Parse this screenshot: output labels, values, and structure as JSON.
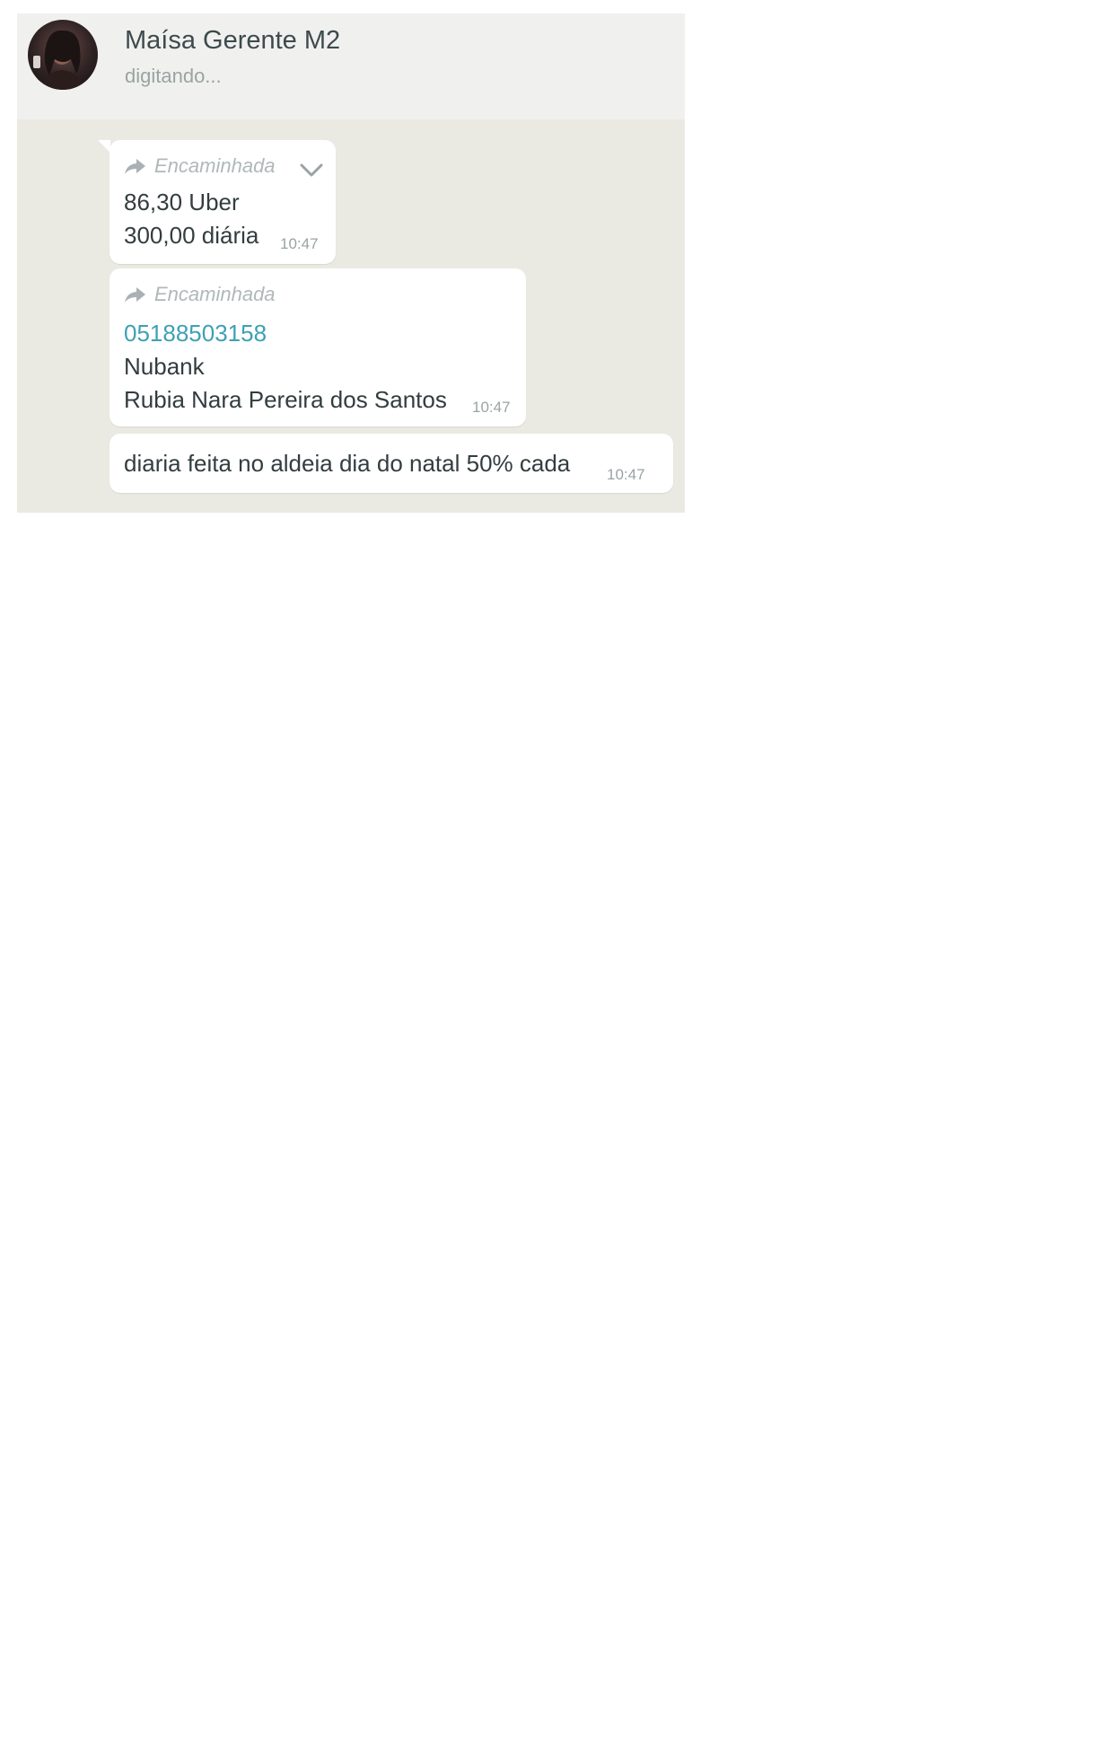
{
  "contact": {
    "name": "Maísa Gerente M2",
    "status": "digitando..."
  },
  "messages": [
    {
      "forwarded_label": "Encaminhada",
      "lines": [
        "86,30 Uber",
        "300,00 diária"
      ],
      "time": "10:47"
    },
    {
      "forwarded_label": "Encaminhada",
      "link": "05188503158",
      "lines": [
        "Nubank",
        "Rubia Nara Pereira dos Santos"
      ],
      "time": "10:47"
    },
    {
      "text": "diaria feita no aldeia dia do natal 50% cada",
      "time": "10:47"
    }
  ],
  "icons": {
    "forward": "forward-arrow-icon",
    "menu": "chevron-down-icon",
    "avatar": "contact-avatar"
  },
  "colors": {
    "chat_background": "#eaeae3",
    "header_background": "#f0f1ee",
    "bubble": "#ffffff",
    "link": "#3ea0b5"
  }
}
